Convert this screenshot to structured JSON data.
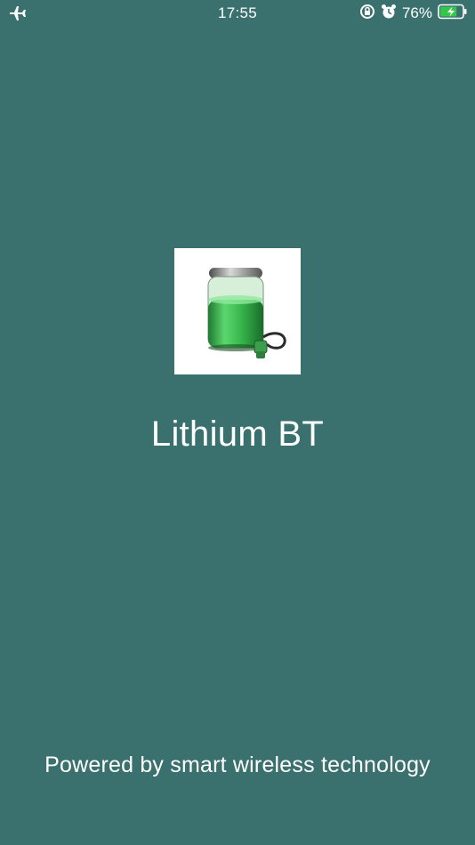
{
  "theme": {
    "background": "#3A716E",
    "text": "#FFFFFF",
    "battery_fill": "#33C84A"
  },
  "status_bar": {
    "left_icon": "airplane-icon",
    "time": "17:55",
    "icons": [
      "rotation-lock-icon",
      "alarm-icon"
    ],
    "battery_percent_text": "76%",
    "battery_level": 0.76,
    "charging": true
  },
  "splash": {
    "logo_icon": "battery-charging-logo-icon",
    "title": "Lithium BT",
    "footer": "Powered by smart wireless technology"
  }
}
